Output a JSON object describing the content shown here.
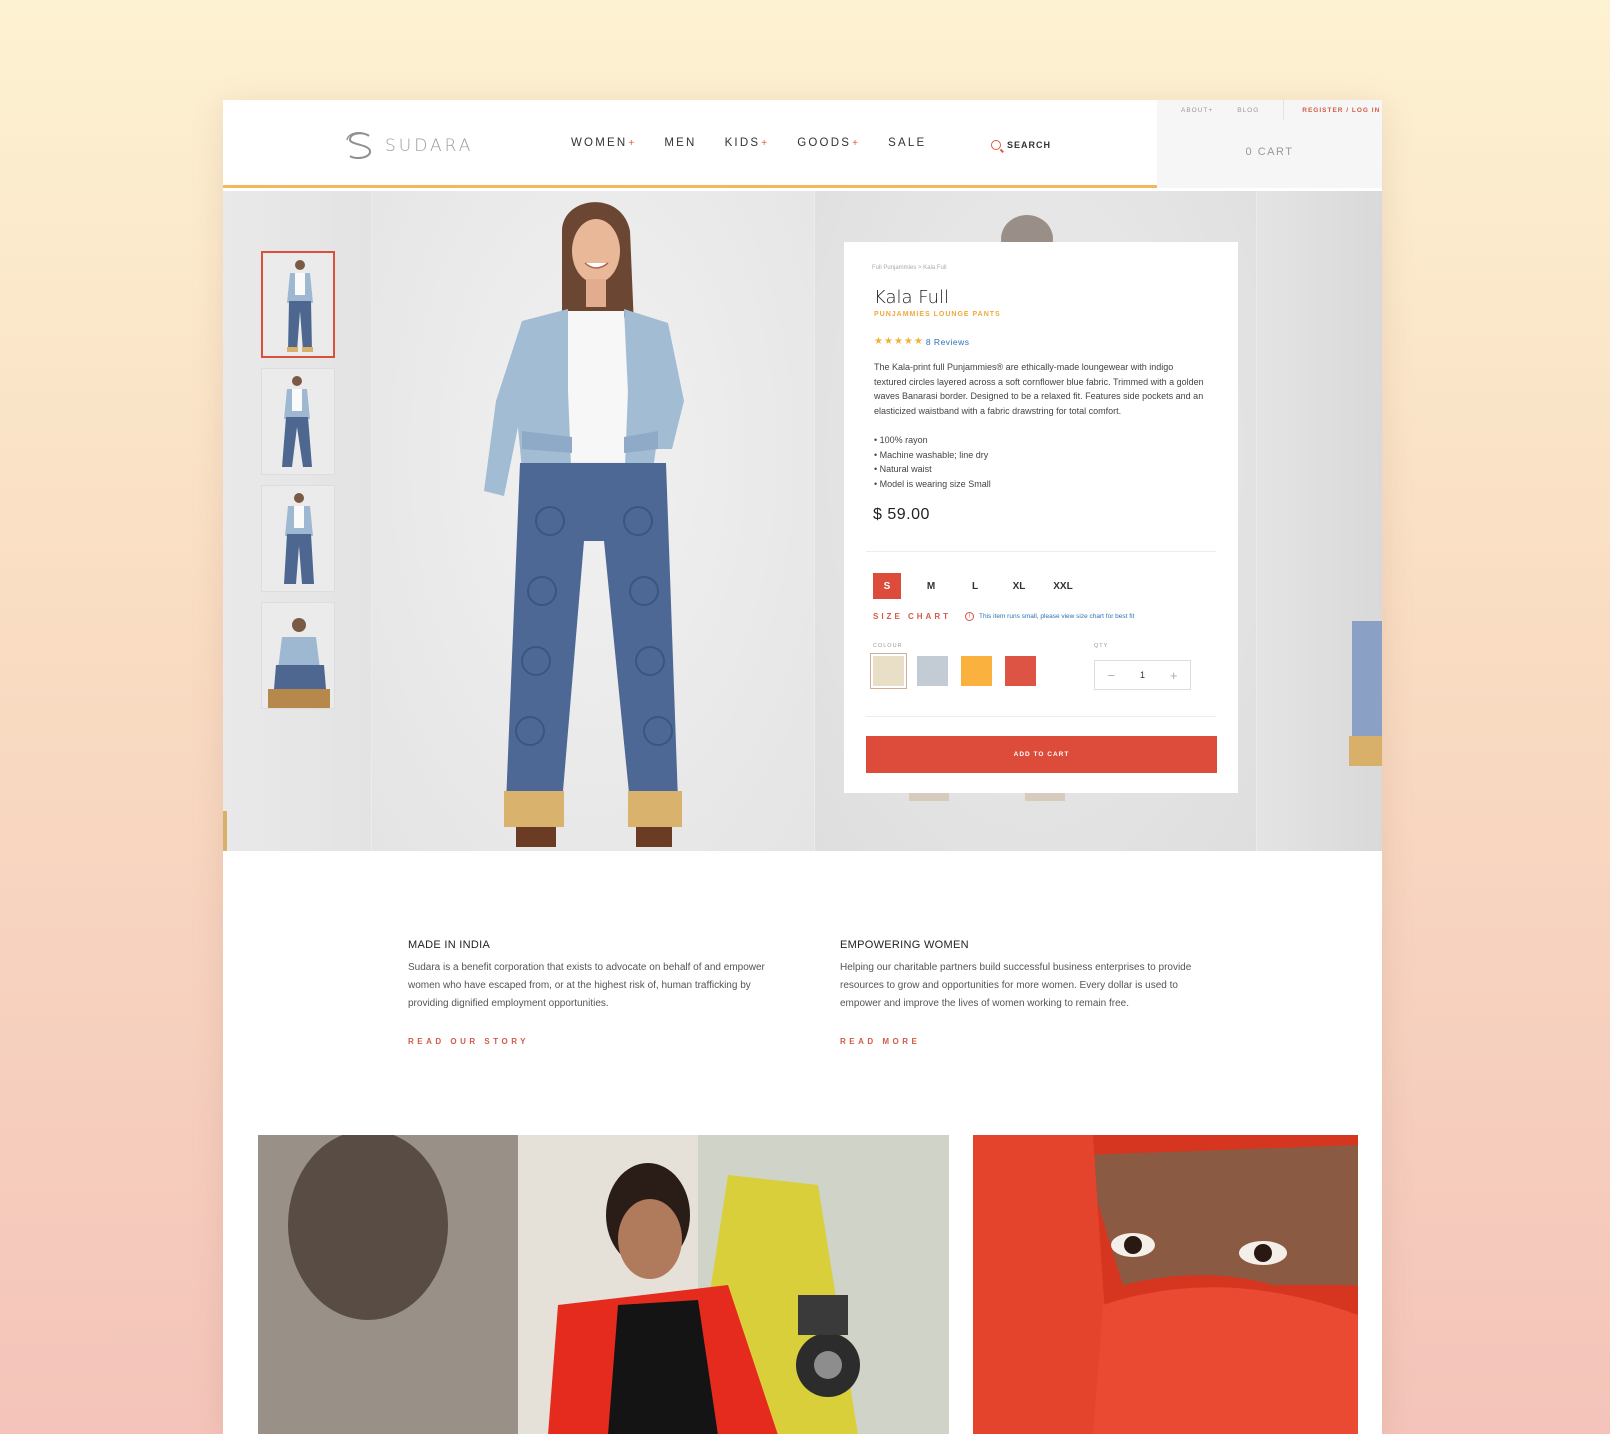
{
  "header": {
    "logo_text": "SUDARA",
    "nav": [
      {
        "label": "WOMEN",
        "plus": "+"
      },
      {
        "label": "MEN",
        "plus": ""
      },
      {
        "label": "KIDS",
        "plus": "+"
      },
      {
        "label": "GOODS",
        "plus": "+"
      },
      {
        "label": "SALE",
        "plus": ""
      }
    ],
    "search_label": "SEARCH",
    "about_label": "ABOUT+",
    "blog_label": "BLOG",
    "register_label": "REGISTER / LOG IN",
    "cart_label": "0 CART"
  },
  "product": {
    "breadcrumb": "Full Punjammies > Kala Full",
    "title": "Kala Full",
    "subtitle": "PUNJAMMIES LOUNGE PANTS",
    "rating": 5,
    "reviews_label": "8 Reviews",
    "description": "The Kala-print full Punjammies® are ethically-made loungewear with indigo textured circles layered across a soft cornflower blue fabric. Trimmed with a golden waves Banarasi border. Designed to be a relaxed fit. Features side pockets and an elasticized waistband with a fabric drawstring for total comfort.",
    "bullets": [
      "• 100% rayon",
      "• Machine washable; line dry",
      "• Natural waist",
      "• Model is wearing size Small"
    ],
    "price": "$ 59.00",
    "sizes": [
      "S",
      "M",
      "L",
      "XL",
      "XXL"
    ],
    "selected_size": "S",
    "size_chart_label": "SIZE CHART",
    "size_note": "This item runs small, please view size chart for best fit",
    "colour_label": "COLOUR",
    "qty_label": "QTY",
    "colours": [
      "#e8dfc6",
      "#c3cbd4",
      "#fbb13e",
      "#dd5444"
    ],
    "qty": "1",
    "add_to_cart": "ADD TO CART"
  },
  "info": [
    {
      "title": "MADE IN INDIA",
      "body": "Sudara is a benefit corporation that exists to advocate on behalf of and empower women who have escaped from, or at the highest risk of, human trafficking by providing dignified employment opportunities.",
      "link": "READ OUR STORY"
    },
    {
      "title": "EMPOWERING WOMEN",
      "body": "Helping our charitable partners build successful business enterprises to provide resources to grow and opportunities for more women. Every dollar is used to empower and improve the lives of women working to remain free.",
      "link": "READ MORE"
    }
  ],
  "colors": {
    "accent": "#dd4c3a",
    "gold": "#f2b85c",
    "link_blue": "#2b73b7"
  }
}
